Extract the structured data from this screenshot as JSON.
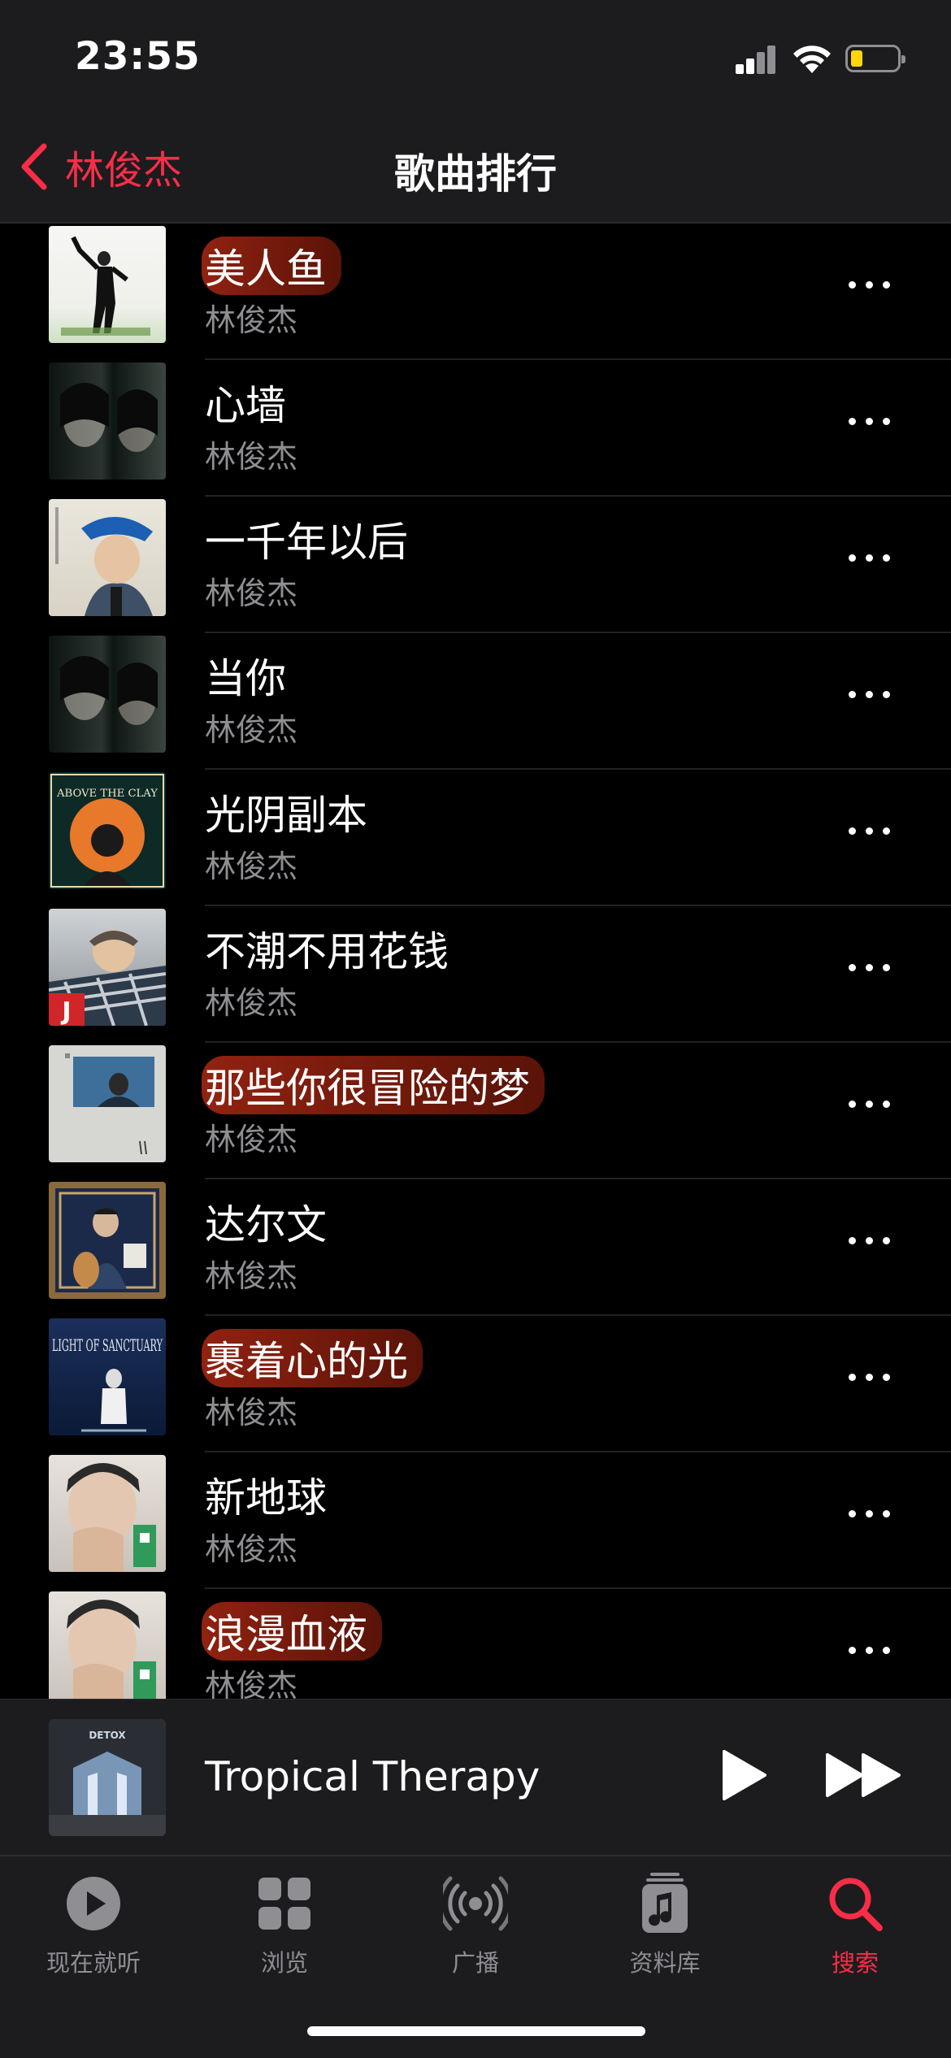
{
  "status": {
    "time": "23:55"
  },
  "nav": {
    "back_label": "林俊杰",
    "title": "歌曲排行"
  },
  "songs": [
    {
      "title": "美人鱼",
      "artist": "林俊杰",
      "highlighted": true
    },
    {
      "title": "心墙",
      "artist": "林俊杰",
      "highlighted": false
    },
    {
      "title": "一千年以后",
      "artist": "林俊杰",
      "highlighted": false
    },
    {
      "title": "当你",
      "artist": "林俊杰",
      "highlighted": false
    },
    {
      "title": "光阴副本",
      "artist": "林俊杰",
      "highlighted": false
    },
    {
      "title": "不潮不用花钱",
      "artist": "林俊杰",
      "highlighted": false
    },
    {
      "title": "那些你很冒险的梦",
      "artist": "林俊杰",
      "highlighted": true
    },
    {
      "title": "达尔文",
      "artist": "林俊杰",
      "highlighted": false
    },
    {
      "title": "裹着心的光",
      "artist": "林俊杰",
      "highlighted": true
    },
    {
      "title": "新地球",
      "artist": "林俊杰",
      "highlighted": false
    },
    {
      "title": "浪漫血液",
      "artist": "林俊杰",
      "highlighted": true
    }
  ],
  "album_art": {
    "light_of_sanctuary": "LIGHT OF SANCTUARY",
    "above_the_clay": "ABOVE THE CLAY",
    "detox": "DETOX"
  },
  "now_playing": {
    "title": "Tropical Therapy"
  },
  "tabs": [
    {
      "label": "现在就听",
      "icon": "play-circle-icon"
    },
    {
      "label": "浏览",
      "icon": "grid-icon"
    },
    {
      "label": "广播",
      "icon": "radio-icon"
    },
    {
      "label": "资料库",
      "icon": "music-note-library-icon"
    },
    {
      "label": "搜索",
      "icon": "search-icon",
      "active": true
    }
  ],
  "colors": {
    "accent": "#fa2d48",
    "background": "#000000",
    "bar": "#1c1c1e",
    "secondary_text": "#8e8e93",
    "highlight": "#a8281a"
  }
}
